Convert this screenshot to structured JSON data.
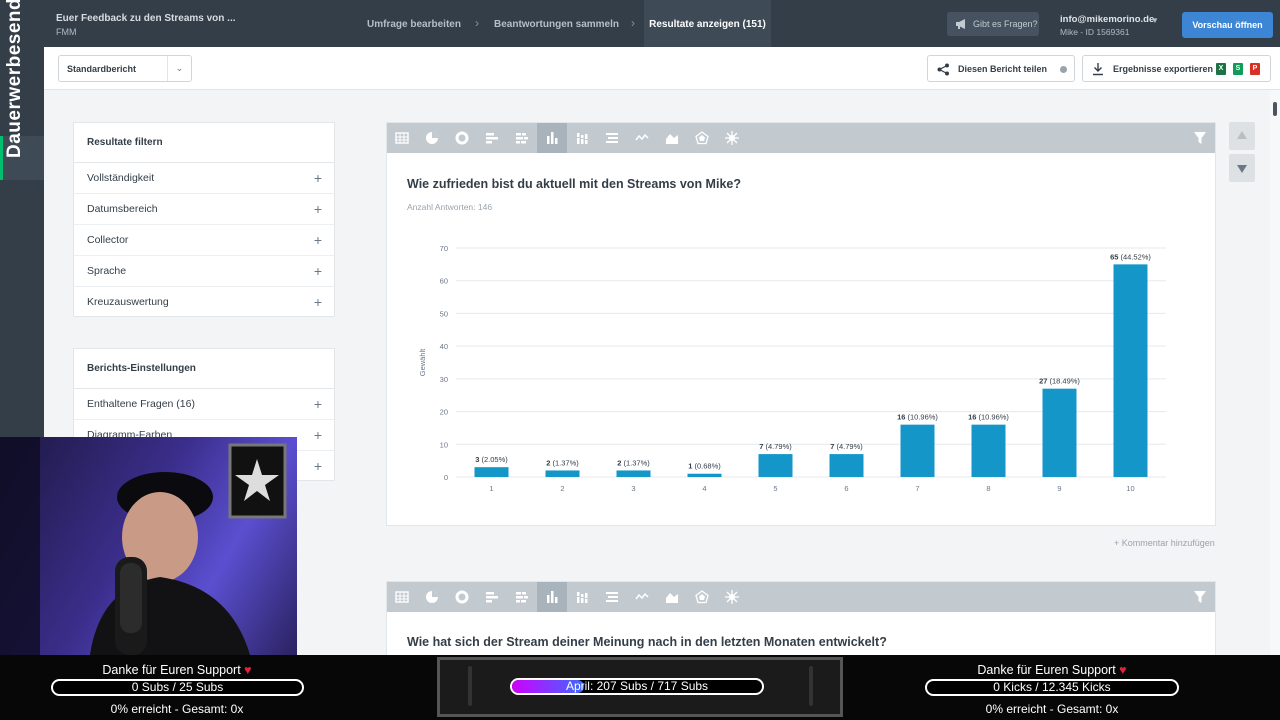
{
  "rail": {
    "vertical_text": "Dauerwerbesendung"
  },
  "topbar": {
    "survey_title": "Euer Feedback zu den Streams von ...",
    "survey_subtitle": "FMM",
    "steps": [
      {
        "label": "Umfrage bearbeiten"
      },
      {
        "label": "Beantwortungen sammeln"
      },
      {
        "label": "Resultate anzeigen (151)"
      }
    ],
    "ask_button": "Gibt es Fragen?",
    "user_email": "info@mikemorino.de",
    "user_id": "Mike - ID 1569361",
    "preview_button": "Vorschau öffnen"
  },
  "subbar": {
    "report_select_value": "Standardbericht",
    "share_button": "Diesen Bericht teilen",
    "export_button": "Ergebnisse exportieren",
    "export_formats": [
      {
        "label": "X",
        "color": "#1f7244"
      },
      {
        "label": "S",
        "color": "#0f9d58"
      },
      {
        "label": "P",
        "color": "#d93025"
      }
    ]
  },
  "filter_panel": {
    "title": "Resultate filtern",
    "items": [
      "Vollständigkeit",
      "Datumsbereich",
      "Collector",
      "Sprache",
      "Kreuzauswertung"
    ]
  },
  "settings_panel": {
    "title": "Berichts-Einstellungen",
    "items": [
      "Enthaltene Fragen (16)",
      "Diagramm-Farben",
      ""
    ]
  },
  "questions": [
    {
      "title": "Wie zufrieden bist du aktuell mit den Streams von Mike?",
      "answer_count": "Anzahl Antworten: 146"
    },
    {
      "title": "Wie hat sich der Stream deiner Meinung nach in den letzten Monaten entwickelt?"
    }
  ],
  "toolbar_icons": [
    "table-icon",
    "pie-icon",
    "donut-icon",
    "horizontal-bar-icon",
    "stacked-horizontal-bar-icon",
    "vertical-bar-icon",
    "stacked-vertical-bar-icon",
    "horizontal-100-bar-icon",
    "line-icon",
    "area-icon",
    "radar-icon",
    "burst-icon"
  ],
  "comment_link": "+ Kommentar hinzufügen",
  "chart_data": {
    "type": "bar",
    "title": "Wie zufrieden bist du aktuell mit den Streams von Mike?",
    "ylabel": "Gewählt",
    "xlabel": "",
    "ylim": [
      0,
      70
    ],
    "yticks": [
      0,
      10,
      20,
      30,
      40,
      50,
      60,
      70
    ],
    "categories": [
      "1",
      "2",
      "3",
      "4",
      "5",
      "6",
      "7",
      "8",
      "9",
      "10"
    ],
    "values": [
      3,
      2,
      2,
      1,
      7,
      7,
      16,
      16,
      27,
      65
    ],
    "labels": [
      "(2.05%)",
      "(1.37%)",
      "(1.37%)",
      "(0.68%)",
      "(4.79%)",
      "(4.79%)",
      "(10.96%)",
      "(10.96%)",
      "(18.49%)",
      "(44.52%)"
    ],
    "grid": true,
    "color": "#1496c8"
  },
  "stream_bar": {
    "left": {
      "title": "Danke für Euren Support",
      "bar_text": "0 Subs / 25 Subs",
      "progress": 0,
      "sub": "0% erreicht - Gesamt: 0x"
    },
    "center": {
      "bar_text": "April: 207 Subs / 717 Subs",
      "progress": 0.289
    },
    "right": {
      "title": "Danke für Euren Support",
      "bar_text": "0 Kicks / 12.345 Kicks",
      "progress": 0,
      "sub": "0% erreicht - Gesamt: 0x"
    }
  }
}
